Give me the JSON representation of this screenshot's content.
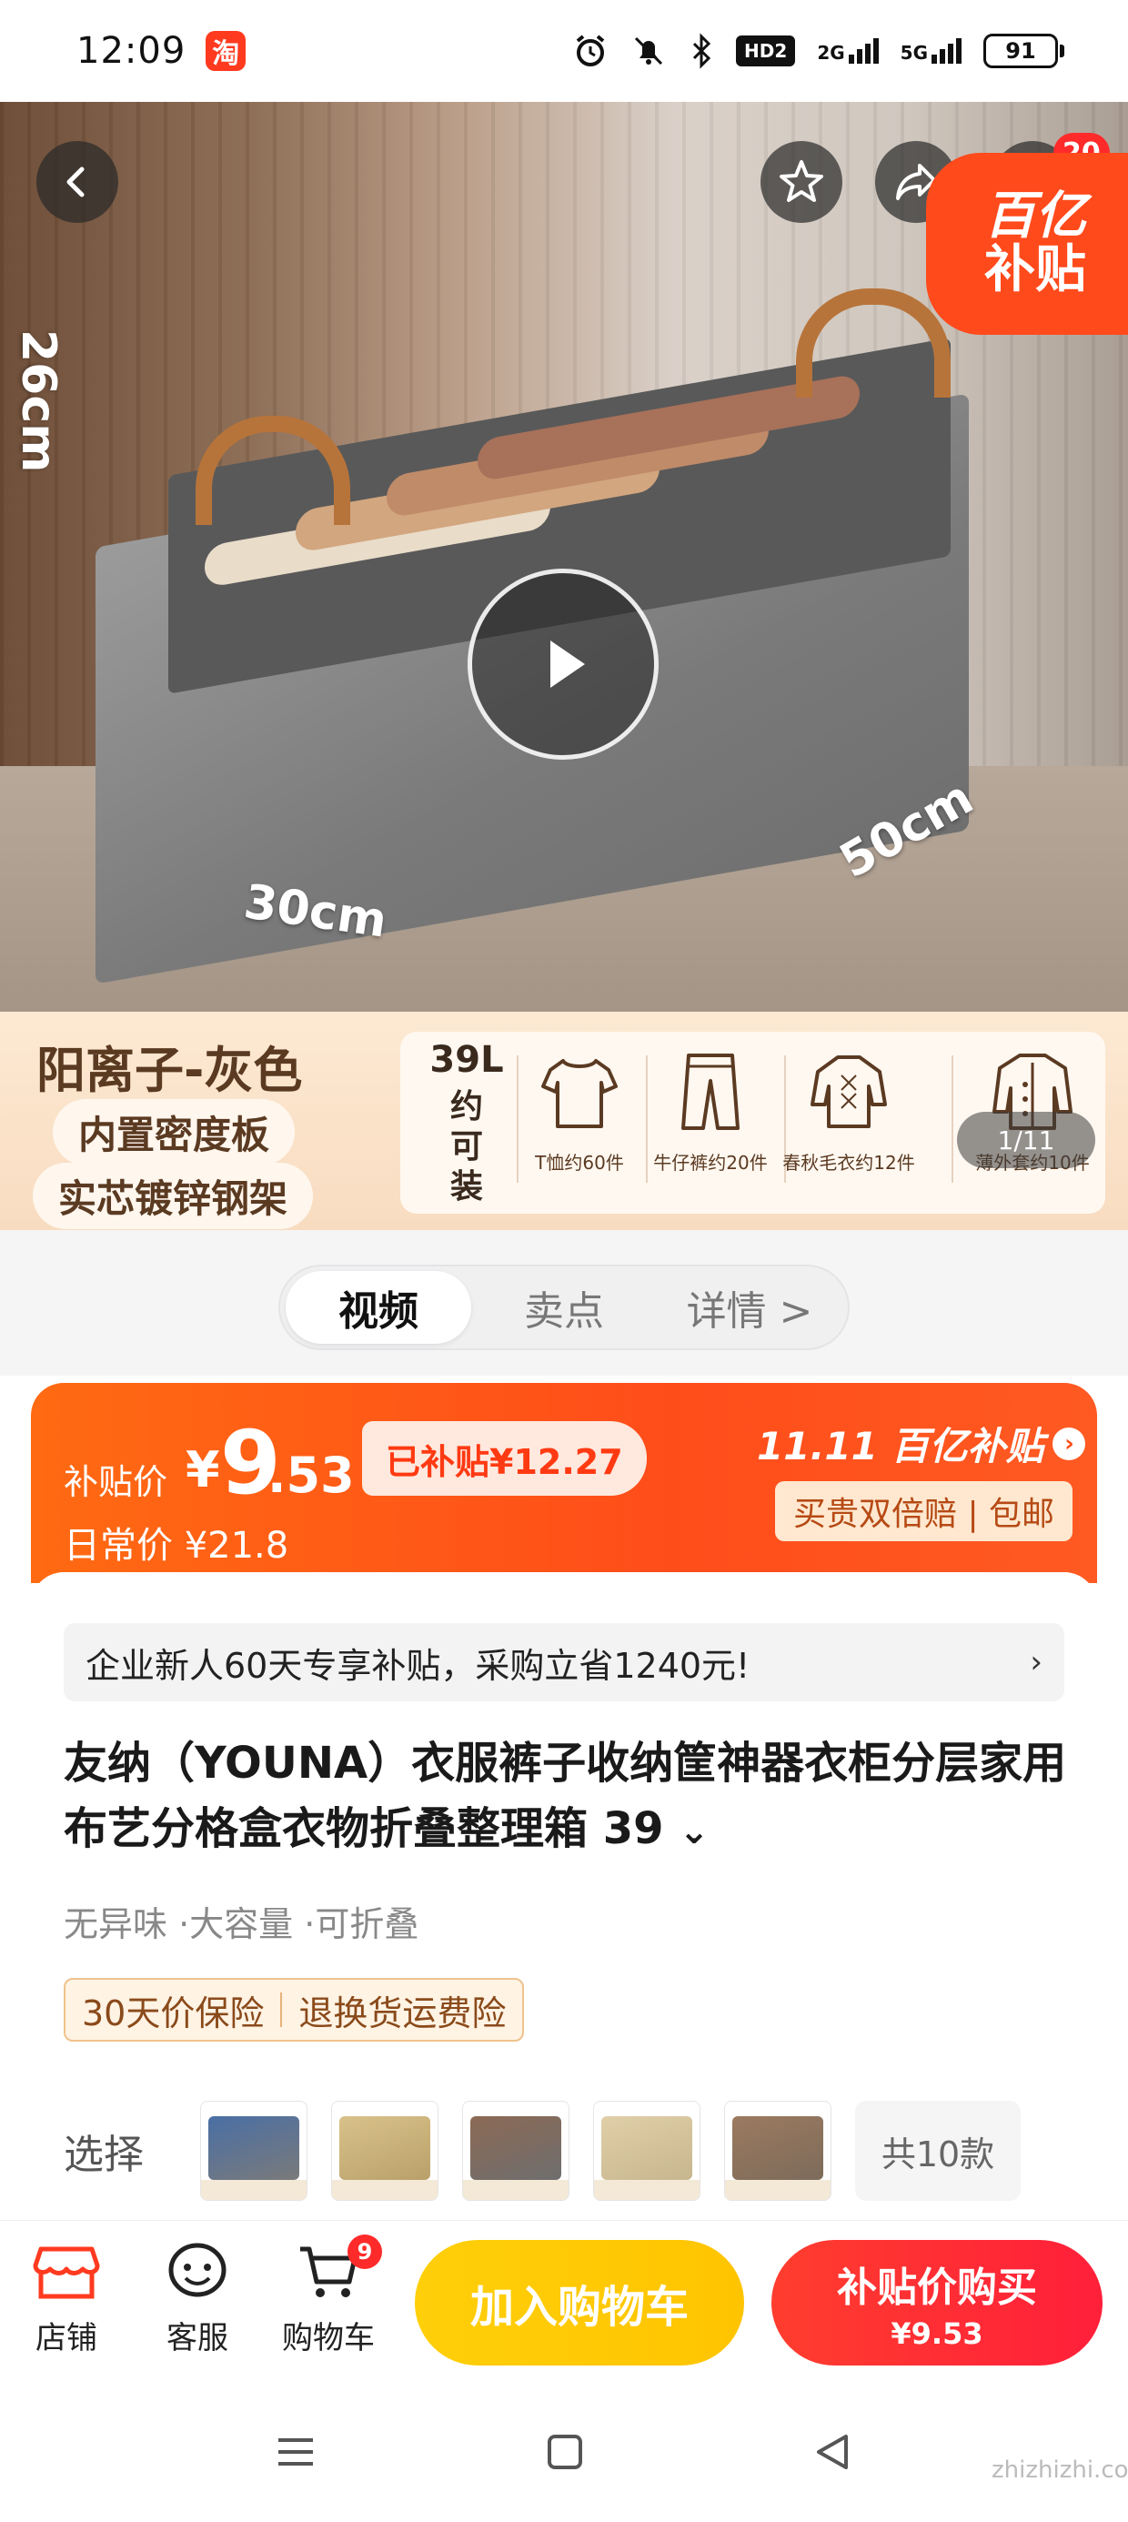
{
  "status_bar": {
    "time": "12:09",
    "app_badge": "淘",
    "network_1": "2G",
    "network_2": "5G",
    "battery": "91",
    "hd_label": "HD2"
  },
  "hero": {
    "dimension_height": "26cm",
    "dimension_width": "30cm",
    "dimension_depth": "50cm",
    "subsidy_line1": "百亿",
    "subsidy_line2": "补贴",
    "notification_count": "20",
    "image_counter": "1/11",
    "icons": {
      "back": "back-icon",
      "favorite": "star-icon",
      "share": "share-icon",
      "more": "more-icon",
      "play": "play-icon"
    }
  },
  "feature_banner": {
    "title": "阳离子-灰色",
    "pill_1": "内置密度板",
    "pill_2": "实芯镀锌钢架",
    "capacity": "39L",
    "capacity_sub": "约可装",
    "items": [
      {
        "label": "T恤约60件",
        "icon": "tshirt-icon"
      },
      {
        "label": "牛仔裤约20件",
        "icon": "jeans-icon"
      },
      {
        "label": "春秋毛衣约12件",
        "icon": "sweater-icon"
      },
      {
        "label": "薄外套约10件",
        "icon": "jacket-icon"
      }
    ]
  },
  "tabs": [
    {
      "label": "视频",
      "active": true
    },
    {
      "label": "卖点",
      "active": false
    },
    {
      "label": "详情 >",
      "active": false
    }
  ],
  "price_card": {
    "subsidy_label": "补贴价",
    "yen": "¥",
    "price_int": "9",
    "price_dec": ".53",
    "saved": "已补贴¥12.27",
    "regular_label": "日常价 ¥21.8",
    "brand": "11.11 百亿补贴",
    "services": "买贵双倍赔 | 包邮",
    "accent_color": "#ff4d1a"
  },
  "product": {
    "promo": "企业新人60天专享补贴，采购立省1240元!",
    "title": "友纳（YOUNA）衣服裤子收纳筐神器衣柜分层家用布艺分格盒衣物折叠整理箱 39",
    "tags": "无异味 ·大容量 ·可折叠",
    "guarantee_1": "30天价保险",
    "guarantee_2": "退换货运费险",
    "select_label": "选择",
    "select_more": "共10款"
  },
  "bottom_bar": {
    "store": "店铺",
    "service": "客服",
    "cart": "购物车",
    "cart_count": "9",
    "add_to_cart": "加入购物车",
    "buy_label": "补贴价购买",
    "buy_price": "¥9.53",
    "buy_color": "#ff2a38",
    "cart_button_color": "#ffc800"
  },
  "watermark": "zhizhizhi.com"
}
